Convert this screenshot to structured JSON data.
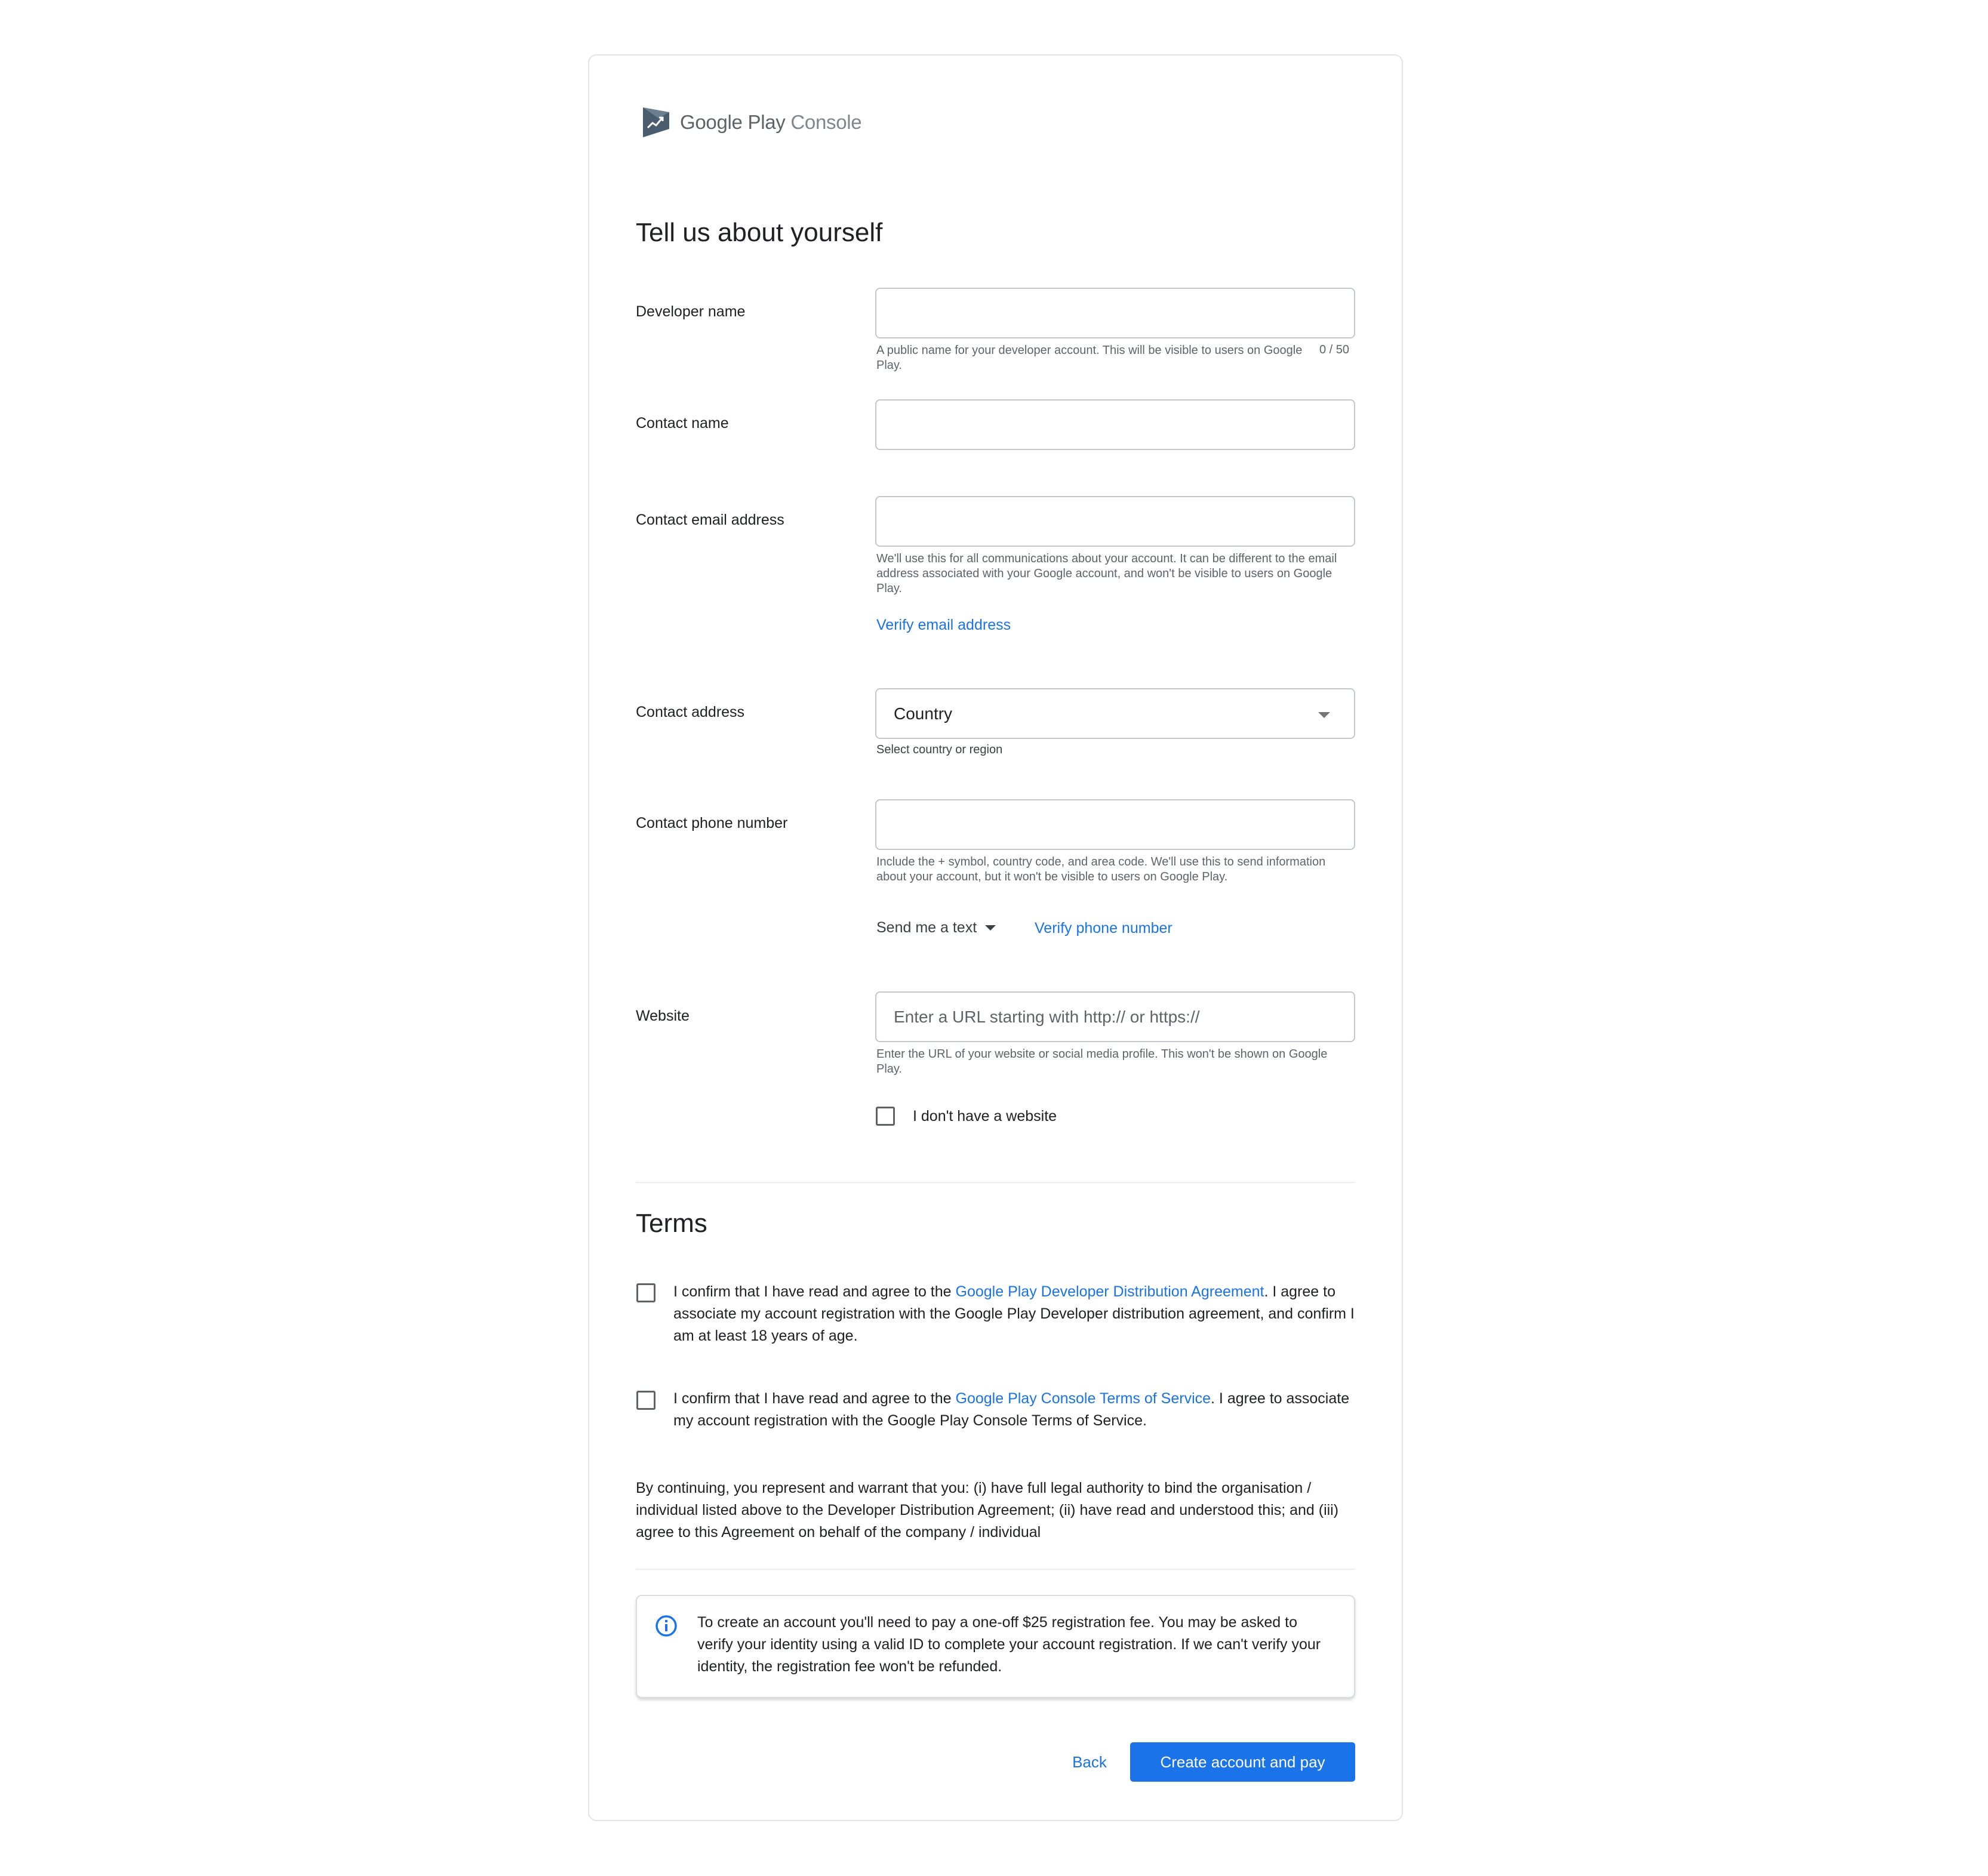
{
  "brand": {
    "name": "Google Play",
    "product": "Console",
    "accent": "#1a73e8"
  },
  "page_title": "Tell us about yourself",
  "fields": {
    "developer_name": {
      "label": "Developer name",
      "value": "",
      "hint": "A public name for your developer account. This will be visible to users on Google Play.",
      "counter": "0 / 50"
    },
    "contact_name": {
      "label": "Contact name",
      "value": ""
    },
    "contact_email": {
      "label": "Contact email address",
      "value": "",
      "hint": "We'll use this for all communications about your account. It can be different to the email address associated with your Google account, and won't be visible to users on Google Play.",
      "verify_link": "Verify email address"
    },
    "contact_address": {
      "label": "Contact address",
      "selected": "Country",
      "hint": "Select country or region"
    },
    "contact_phone": {
      "label": "Contact phone number",
      "value": "",
      "hint": "Include the + symbol, country code, and area code. We'll use this to send information about your account, but it won't be visible to users on Google Play.",
      "method": "Send me a text",
      "verify_link": "Verify phone number"
    },
    "website": {
      "label": "Website",
      "placeholder": "Enter a URL starting with http:// or https://",
      "hint": "Enter the URL of your website or social media profile. This won't be shown on Google Play.",
      "no_website_label": "I don't have a website",
      "no_website_checked": false
    }
  },
  "terms": {
    "title": "Terms",
    "ddA": {
      "pre": "I confirm that I have read and agree to the ",
      "link": "Google Play Developer Distribution Agreement",
      "post": ". I agree to associate my account registration with the Google Play Developer distribution agreement, and confirm I am at least 18 years of age.",
      "checked": false
    },
    "tos": {
      "pre": "I confirm that I have read and agree to the ",
      "link": "Google Play Console Terms of Service",
      "post": ". I agree to associate my account registration with the Google Play Console Terms of Service.",
      "checked": false
    },
    "warranty": "By continuing, you represent and warrant that you: (i) have full legal authority to bind the organisation / individual listed above to the Developer Distribution Agreement; (ii) have read and understood this; and (iii) agree to this Agreement on behalf of the company / individual"
  },
  "notice": {
    "icon": "info-icon",
    "text": "To create an account you'll need to pay a one-off $25 registration fee. You may be asked to verify your identity using a valid ID to complete your account registration. If we can't verify your identity, the registration fee won't be refunded."
  },
  "actions": {
    "back": "Back",
    "submit": "Create account and pay"
  }
}
